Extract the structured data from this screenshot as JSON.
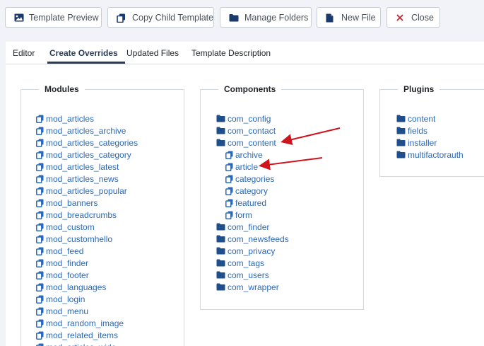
{
  "toolbar": {
    "template_preview": "Template Preview",
    "copy_child_template": "Copy Child Template",
    "manage_folders": "Manage Folders",
    "new_file": "New File",
    "close": "Close"
  },
  "tabs": [
    {
      "label": "Editor"
    },
    {
      "label": "Create Overrides",
      "active": true
    },
    {
      "label": "Updated Files"
    },
    {
      "label": "Template Description"
    }
  ],
  "modules": {
    "title": "Modules",
    "items": [
      "mod_articles",
      "mod_articles_archive",
      "mod_articles_categories",
      "mod_articles_category",
      "mod_articles_latest",
      "mod_articles_news",
      "mod_articles_popular",
      "mod_banners",
      "mod_breadcrumbs",
      "mod_custom",
      "mod_customhello",
      "mod_feed",
      "mod_finder",
      "mod_footer",
      "mod_languages",
      "mod_login",
      "mod_menu",
      "mod_random_image",
      "mod_related_items",
      "mod_articles_wide"
    ]
  },
  "components": {
    "title": "Components",
    "items": [
      {
        "label": "com_config",
        "icon": "folder-icon"
      },
      {
        "label": "com_contact",
        "icon": "folder-icon"
      },
      {
        "label": "com_content",
        "icon": "folder-icon"
      },
      {
        "label": "archive",
        "icon": "copy-icon",
        "child": true
      },
      {
        "label": "article",
        "icon": "copy-icon",
        "child": true
      },
      {
        "label": "categories",
        "icon": "copy-icon",
        "child": true
      },
      {
        "label": "category",
        "icon": "copy-icon",
        "child": true
      },
      {
        "label": "featured",
        "icon": "copy-icon",
        "child": true
      },
      {
        "label": "form",
        "icon": "copy-icon",
        "child": true
      },
      {
        "label": "com_finder",
        "icon": "folder-icon"
      },
      {
        "label": "com_newsfeeds",
        "icon": "folder-icon"
      },
      {
        "label": "com_privacy",
        "icon": "folder-icon"
      },
      {
        "label": "com_tags",
        "icon": "folder-icon"
      },
      {
        "label": "com_users",
        "icon": "folder-icon"
      },
      {
        "label": "com_wrapper",
        "icon": "folder-icon"
      }
    ]
  },
  "plugins": {
    "title": "Plugins",
    "items": [
      "content",
      "fields",
      "installer",
      "multifactorauth"
    ]
  },
  "colors": {
    "link": "#2a69b8",
    "accent": "#2a3b5a",
    "arrow": "#d0141d",
    "close_x": "#c0282e"
  }
}
